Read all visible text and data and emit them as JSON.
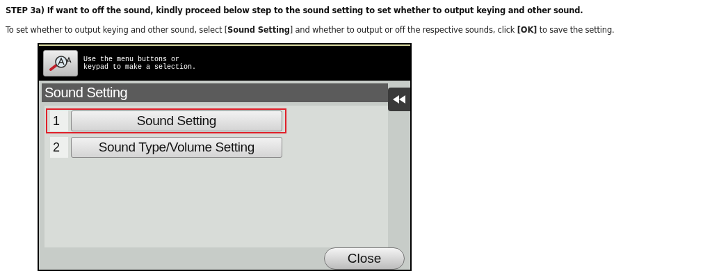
{
  "heading": "STEP 3a) If want to off the sound, kindly proceed below step to the sound setting to set whether to output keying and other sound.",
  "instruction": "To set whether to output keying and other sound, select [**Sound Setting**] and whether to output or off the respective sounds, click **[OK]** to save the setting.",
  "panel": {
    "message": "Use the menu buttons or\nkeypad to make a selection.",
    "title": "Sound Setting",
    "menu_items": [
      {
        "number": "1",
        "label": "Sound Setting",
        "selected": true
      },
      {
        "number": "2",
        "label": "Sound Type/Volume Setting",
        "selected": false
      }
    ],
    "close_button": "Close"
  }
}
